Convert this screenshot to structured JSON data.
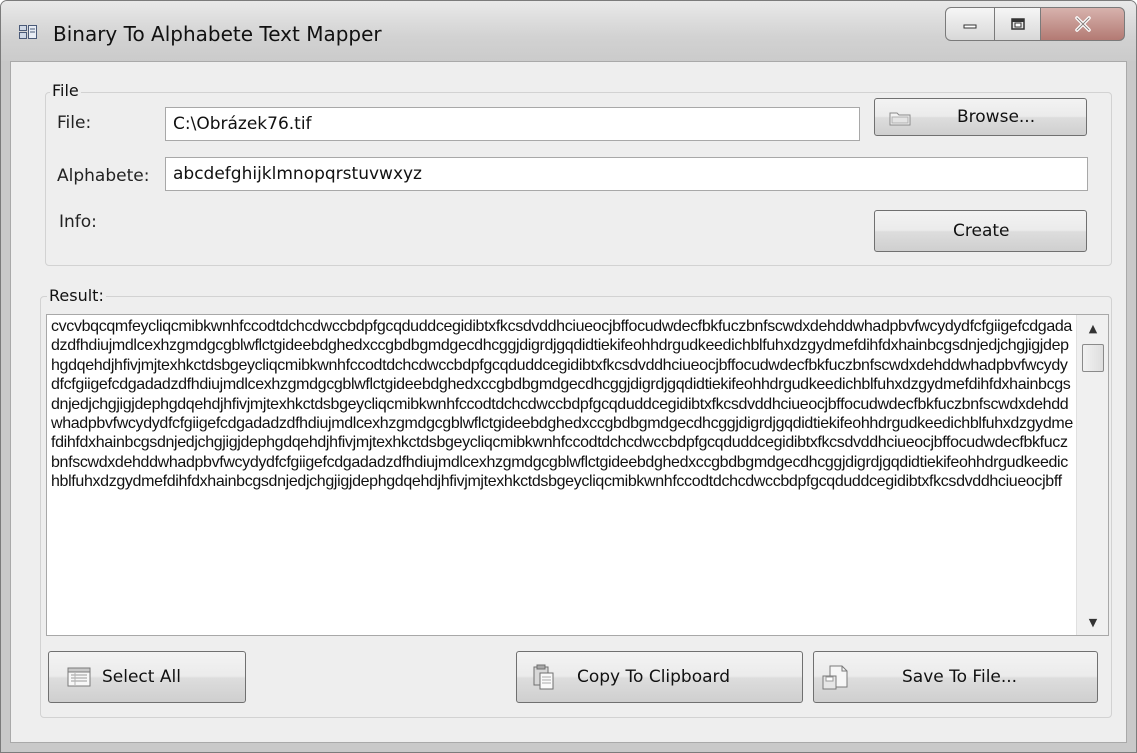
{
  "window": {
    "title": "Binary To Alphabete Text Mapper",
    "controls": {
      "minimize": "minimize-icon",
      "maximize": "maximize-icon",
      "close": "close-icon"
    }
  },
  "file_group": {
    "legend": "File",
    "file_label": "File:",
    "file_value": "C:\\Obrázek76.tif",
    "browse_label": "Browse...",
    "alphabete_label": "Alphabete:",
    "alphabete_value": "abcdefghijklmnopqrstuvwxyz",
    "info_label": "Info:",
    "create_label": "Create"
  },
  "result_group": {
    "legend": "Result:",
    "text": "cvcvbqcqmfeycliqcmibkwnhfccodtdchcdwccbdpfgcqduddcegidibtxfkcsdvddhciueocjbffocudwdecfbkfuczbnfscwdxdehddwhadpbvfwcydydfcfgiigefcdgadadzdfhdiujmdlcexhzgmdgcgblwflctgideebdghedxccgbdbgmdgecdhcggjdigrdjgqdidtiekifeohhdrgudkeedichblfuhxdzgydmefdihfdxhainbcgsdnjedjchgjigjdephgdqehdjhfivjmjtexhkctdsbgeycliqcmibkwnhfccodtdchcdwccbdpfgcqduddcegidibtxfkcsdvddhciueocjbffocudwdecfbkfuczbnfscwdxdehddwhadpbvfwcydydfcfgiigefcdgadadzdfhdiujmdlcexhzgmdgcgblwflctgideebdghedxccgbdbgmdgecdhcggjdigrdjgqdidtiekifeohhdrgudkeedichblfuhxdzgydmefdihfdxhainbcgsdnjedjchgjigjdephgdqehdjhfivjmjtexhkctdsbgeycliqcmibkwnhfccodtdchcdwccbdpfgcqduddcegidibtxfkcsdvddhciueocjbffocudwdecfbkfuczbnfscwdxdehddwhadpbvfwcydydfcfgiigefcdgadadzdfhdiujmdlcexhzgmdgcgblwflctgideebdghedxccgbdbgmdgecdhcggjdigrdjgqdidtiekifeohhdrgudkeedichblfuhxdzgydmefdihfdxhainbcgsdnjedjchgjigjdephgdqehdjhfivjmjtexhkctdsbgeycliqcmibkwnhfccodtdchcdwccbdpfgcqduddcegidibtxfkcsdvddhciueocjbffocudwdecfbkfuczbnfscwdxdehddwhadpbvfwcydydfcfgiigefcdgadadzdfhdiujmdlcexhzgmdgcgblwflctgideebdghedxccgbdbgmdgecdhcggjdigrdjgqdidtiekifeohhdrgudkeedichblfuhxdzgydmefdihfdxhainbcgsdnjedjchgjigjdephgdqehdjhfivjmjtexhkctdsbgeycliqcmibkwnhfccodtdchcdwccbdpfgcqduddcegidibtxfkcsdvddhciueocjbff"
  },
  "buttons": {
    "select_all": "Select All",
    "copy_to_clipboard": "Copy To Clipboard",
    "save_to_file": "Save To File..."
  },
  "colors": {
    "close_button": "#c0837b",
    "window_background": "#eeeeee"
  }
}
